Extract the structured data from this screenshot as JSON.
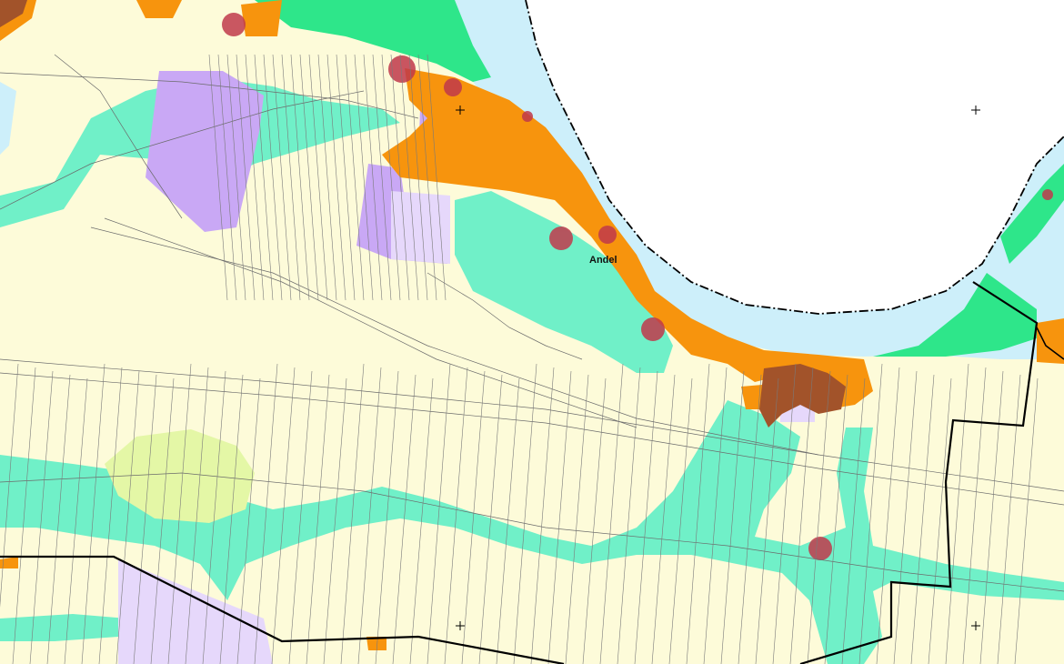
{
  "map": {
    "place_label": "Andel",
    "colors": {
      "background": "#fdfbd9",
      "water": "#cdeffa",
      "green_area": "#2ee68a",
      "turquoise_zone": "#70f0c8",
      "orange_zone": "#f7940d",
      "brown_zone": "#a2532a",
      "purple_zone": "#c9a8f5",
      "light_purple": "#e6d8fb",
      "red_marker": "#c0394b",
      "yellow_green": "#e4f7a6"
    },
    "icons": [
      "cross-marker-icon",
      "cross-marker-icon",
      "cross-marker-icon",
      "cross-marker-icon"
    ]
  }
}
